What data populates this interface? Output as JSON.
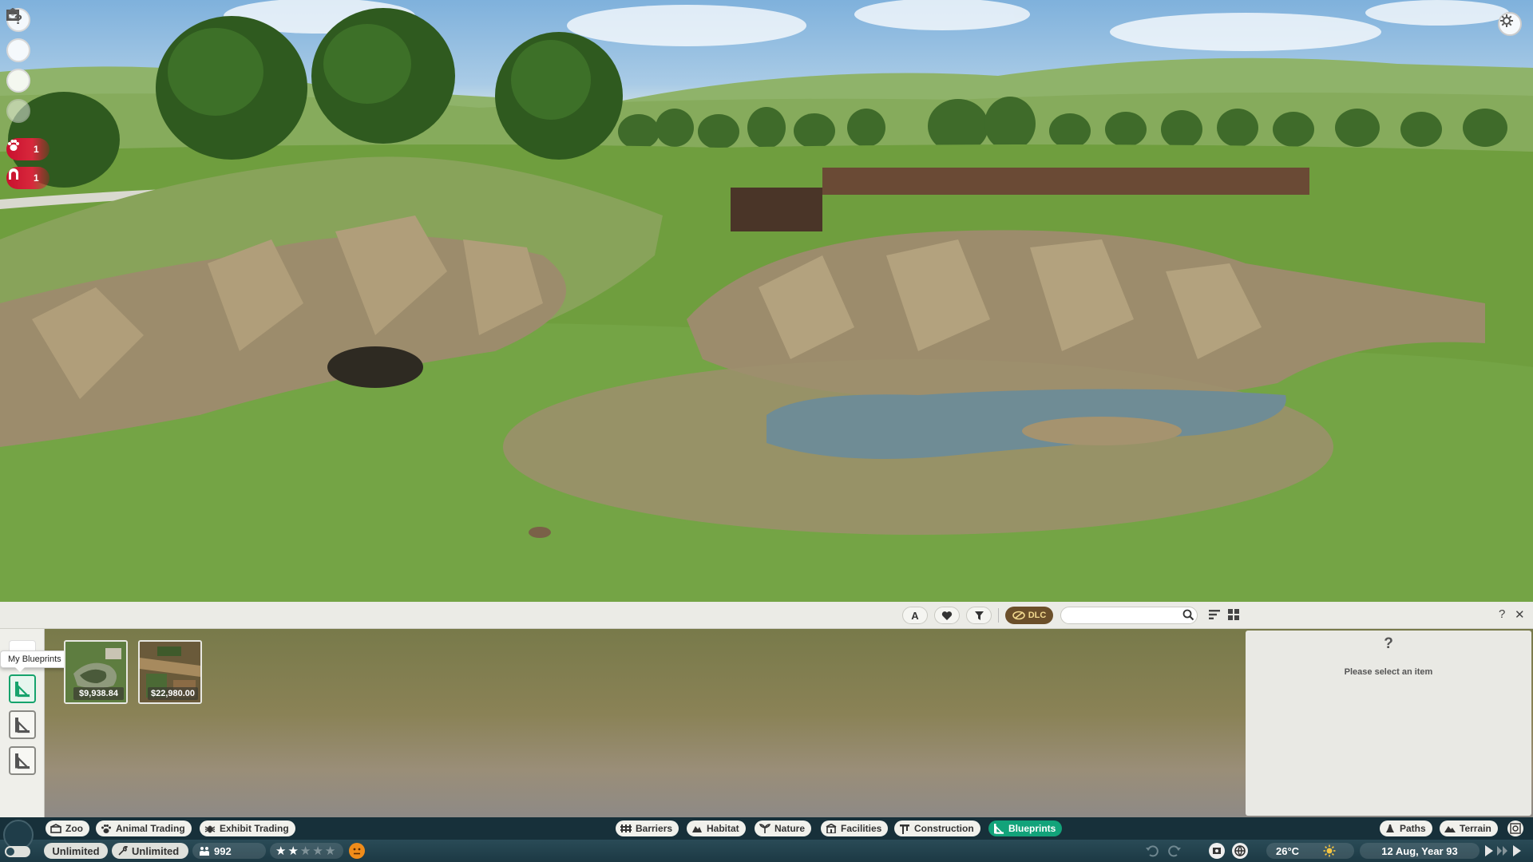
{
  "hud": {
    "alerts": [
      {
        "name": "animal-alert",
        "count": "1"
      },
      {
        "name": "staff-alert",
        "count": "1"
      }
    ]
  },
  "toolbar": {
    "dlc_label": "DLC",
    "search_placeholder": "",
    "help_label": "?",
    "close_label": "✕"
  },
  "side_tabs": {
    "tooltip": "My Blueprints"
  },
  "items": [
    {
      "price": "$9,938.84"
    },
    {
      "price": "$22,980.00"
    }
  ],
  "info_panel": {
    "icon": "?",
    "message": "Please select an item"
  },
  "left_tabs": [
    {
      "label": "Zoo",
      "icon": "zoo-icon"
    },
    {
      "label": "Animal Trading",
      "icon": "paw-icon"
    },
    {
      "label": "Exhibit Trading",
      "icon": "bug-icon"
    }
  ],
  "categories": [
    {
      "label": "Barriers",
      "icon": "barrier-icon",
      "active": false
    },
    {
      "label": "Habitat",
      "icon": "habitat-icon",
      "active": false
    },
    {
      "label": "Nature",
      "icon": "nature-icon",
      "active": false
    },
    {
      "label": "Facilities",
      "icon": "facilities-icon",
      "active": false
    },
    {
      "label": "Construction",
      "icon": "construction-icon",
      "active": false
    },
    {
      "label": "Blueprints",
      "icon": "blueprint-icon",
      "active": true
    }
  ],
  "right_tabs": [
    {
      "label": "Paths",
      "icon": "paths-icon"
    },
    {
      "label": "Terrain",
      "icon": "terrain-icon"
    }
  ],
  "status": {
    "money": "Unlimited",
    "research": "Unlimited",
    "guests": "992",
    "rating": 2,
    "rating_max": 5,
    "temperature": "26°C",
    "date": "12 Aug, Year 93"
  },
  "colors": {
    "accent": "#12a37a",
    "alert": "#c8102e",
    "bar_dark": "#17303a"
  }
}
